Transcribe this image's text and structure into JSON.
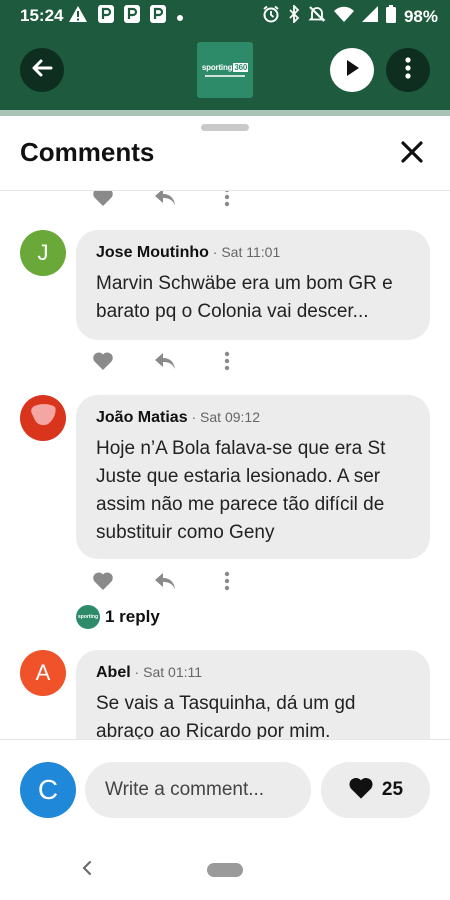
{
  "status_bar": {
    "time": "15:24",
    "battery": "98%",
    "left_icons": [
      "alert-icon",
      "parking-icon",
      "parking-icon",
      "parking-icon",
      "dot-icon"
    ],
    "right_icons": [
      "alarm-icon",
      "bluetooth-icon",
      "mute-icon",
      "wifi-icon",
      "signal-icon",
      "battery-icon"
    ]
  },
  "header": {
    "logo_text": "sporting",
    "logo_badge": "360",
    "colors": {
      "bar": "#1e5a3e",
      "logo": "#2e8b6a"
    }
  },
  "sheet": {
    "title": "Comments"
  },
  "comments": [
    {
      "author": "Jose Moutinho",
      "time": "Sat 11:01",
      "avatar_letter": "J",
      "avatar_color": "#6aa83a",
      "text": "Marvin Schwäbe era um bom GR e barato pq o Colonia vai descer..."
    },
    {
      "author": "João Matias",
      "time": "Sat 09:12",
      "avatar_letter": "",
      "avatar_color": "#d9341c",
      "text": "Hoje n’A Bola falava-se que era St Juste que estaria lesionado. A ser assim não me parece tão difícil de substituir como Geny",
      "replies_label": "1 reply"
    },
    {
      "author": "Abel",
      "time": "Sat 01:11",
      "avatar_letter": "A",
      "avatar_color": "#f0522a",
      "text": "Se vais a Tasquinha, dá um gd abraço ao Ricardo por mim."
    }
  ],
  "composer": {
    "avatar_letter": "C",
    "placeholder": "Write a comment...",
    "likes_count": "25"
  }
}
